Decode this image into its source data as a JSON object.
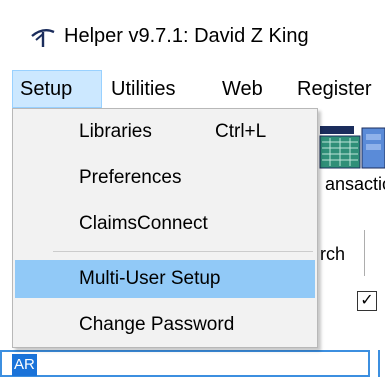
{
  "window": {
    "title": "Helper v9.7.1: David Z King",
    "icon": "helper-app-icon"
  },
  "menubar": {
    "items": [
      {
        "label": "Setup",
        "active": true
      },
      {
        "label": "Utilities"
      },
      {
        "label": "Web"
      },
      {
        "label": "Register"
      }
    ]
  },
  "dropdown": {
    "items": [
      {
        "label": "Libraries",
        "shortcut": "Ctrl+L"
      },
      {
        "label": "Preferences"
      },
      {
        "label": "ClaimsConnect"
      },
      {
        "label": "Multi-User Setup",
        "highlighted": true
      },
      {
        "label": "Change Password"
      }
    ]
  },
  "background": {
    "toolbar_label": "ansactio",
    "tab_label": "rch",
    "checkbox_mark": "✓",
    "field_value": "AR"
  },
  "colors": {
    "menu_active_bg": "#cce8ff",
    "dropdown_bg": "#f2f2f2",
    "dropdown_highlight": "#91c9f7",
    "selection_text_bg": "#1a73d9",
    "field_border": "#3c8fe0"
  }
}
